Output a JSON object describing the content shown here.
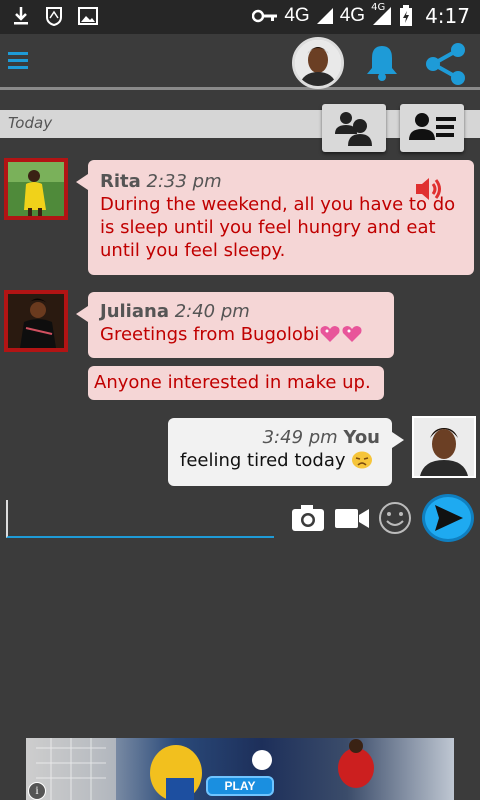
{
  "status_bar": {
    "network1": "4G",
    "network2": "4G",
    "network2_sup": "4G",
    "time": "4:17"
  },
  "date_divider": "Today",
  "messages": [
    {
      "sender": "Rita",
      "time": "2:33 pm",
      "text": "During the weekend, all you have to do is sleep until you feel hungry and eat until you feel sleepy."
    },
    {
      "sender": "Juliana",
      "time": "2:40 pm",
      "text": "Greetings from Bugolobi"
    },
    {
      "text": "Anyone interested in make up."
    },
    {
      "sender": "You",
      "time": "3:49 pm",
      "text": "feeling tired today"
    }
  ],
  "ad": {
    "play_label": "PLAY",
    "info": "i"
  },
  "colors": {
    "accent": "#1e9bd7",
    "bubble_other": "#f5d6d6",
    "bubble_text": "#c00000",
    "bubble_me": "#f2f2f2"
  }
}
